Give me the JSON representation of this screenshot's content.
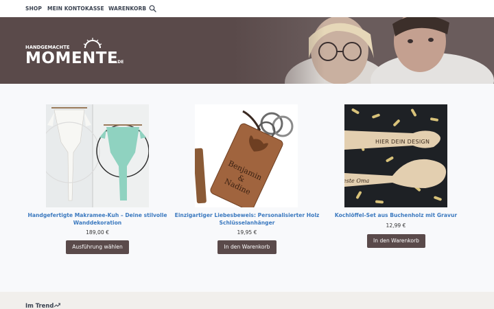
{
  "nav": {
    "items": [
      "SHOP",
      "MEIN KONTO",
      "KASSE",
      "WARENKORB"
    ],
    "search_icon": "search-icon"
  },
  "hero": {
    "logo_top": "HANDGEMACHTE",
    "logo_main": "MOMENTE",
    "logo_suffix": ".DE"
  },
  "products": [
    {
      "title": "Handgefertigte Makramee-Kuh – Deine stilvolle Wanddekoration",
      "price": "189,00 €",
      "button": "Ausführung wählen"
    },
    {
      "title": "Einzigartiger Liebesbeweis: Personalisierter Holz Schlüsselanhänger",
      "price": "19,95 €",
      "button": "In den Warenkorb",
      "engraving": "Benjamin & Nadine"
    },
    {
      "title": "Kochlöffel-Set aus Buchenholz mit Gravur",
      "price": "12,99 €",
      "button": "In den Warenkorb",
      "engraving_top": "HIER DEIN DESIGN",
      "engraving_bottom": "este Oma"
    }
  ],
  "trend": {
    "label": "Im Trend"
  },
  "colors": {
    "brand_brown": "#5a4a4a",
    "link_blue": "#3b79bf"
  }
}
